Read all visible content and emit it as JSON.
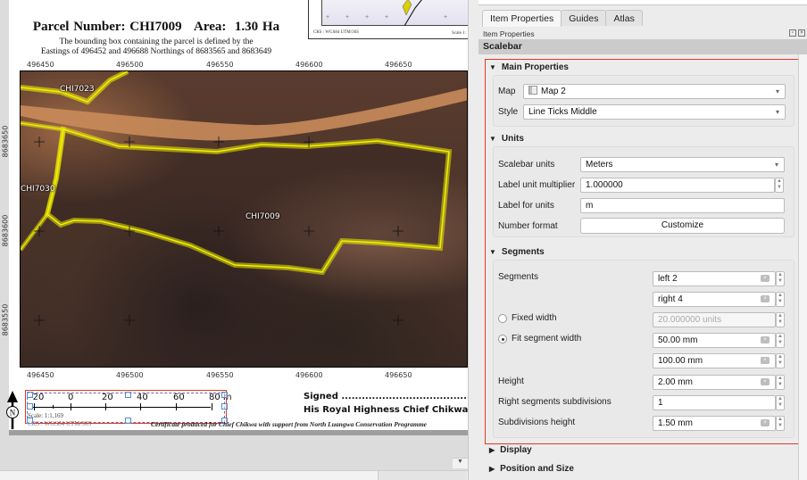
{
  "layout": {
    "title": "Parcel Number: CHI7009   Area:  1.30 Ha",
    "subtitle_line1": "The bounding box containing the parcel is defined by the",
    "subtitle_line2": "Eastings of 496452 and 496688 Northings of 8683565 and 8683649",
    "eastings": [
      "496450",
      "496500",
      "496550",
      "496600",
      "496650"
    ],
    "northings": [
      "8683650",
      "8683600",
      "8683550"
    ],
    "parcel_labels": {
      "main": "CHI7009",
      "north": "CHI7023",
      "west": "CHI7030"
    },
    "overview_map": {
      "crs": "CRS : WGS84 UTM/36S",
      "scale": "Scale 1:"
    },
    "scalebar": {
      "labels": [
        "-20",
        "0",
        "20",
        "40",
        "60",
        "80 m"
      ]
    },
    "scale_text": "Scale: 1:1,169",
    "crs_text": "CRS : WGS84 UTM/36S",
    "north_arrow": "N",
    "signed": "Signed ............................................",
    "signatory": "His Royal Highness Chief Chikwa",
    "certificate": "Certificate produced for Chief Chikwa with support from North Luangwa Conservation Programme"
  },
  "panel": {
    "tabs": [
      {
        "label": "Item Properties",
        "active": true
      },
      {
        "label": "Guides",
        "active": false
      },
      {
        "label": "Atlas",
        "active": false
      }
    ],
    "dock_title": "Item Properties",
    "item_type": "Scalebar",
    "main_properties": {
      "header": "Main Properties",
      "map_label": "Map",
      "map_value": "Map 2",
      "style_label": "Style",
      "style_value": "Line Ticks Middle"
    },
    "units": {
      "header": "Units",
      "scalebar_units_label": "Scalebar units",
      "scalebar_units_value": "Meters",
      "multiplier_label": "Label unit multiplier",
      "multiplier_value": "1.000000",
      "label_for_units_label": "Label for units",
      "label_for_units_value": "m",
      "number_format_label": "Number format",
      "customize_button": "Customize"
    },
    "segments": {
      "header": "Segments",
      "segments_label": "Segments",
      "left_value": "left 2",
      "right_value": "right 4",
      "fixed_width_label": "Fixed width",
      "fixed_width_value": "20.000000 units",
      "fixed_width_selected": false,
      "fit_width_label": "Fit segment width",
      "fit_width_selected": true,
      "fit_min_value": "50.00 mm",
      "fit_max_value": "100.00 mm",
      "height_label": "Height",
      "height_value": "2.00 mm",
      "right_subdiv_label": "Right segments subdivisions",
      "right_subdiv_value": "1",
      "subdiv_height_label": "Subdivisions height",
      "subdiv_height_value": "1.50 mm"
    },
    "collapsed_groups": [
      "Display",
      "Position and Size"
    ]
  },
  "colors": {
    "selection": "#e5371f",
    "parcel_outline": "#f5f500",
    "handle": "#4a90d9"
  }
}
